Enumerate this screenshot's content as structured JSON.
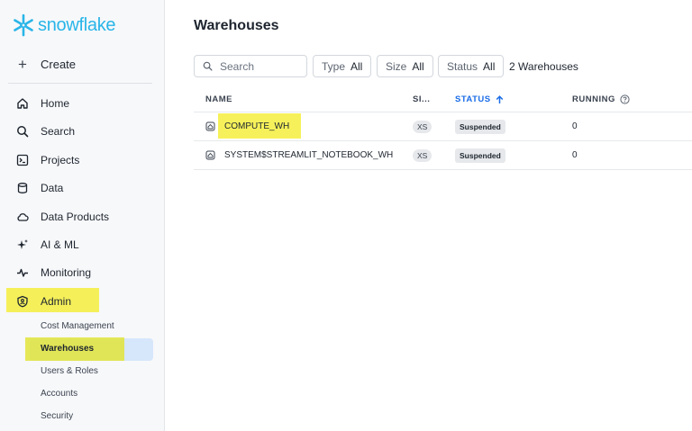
{
  "app": {
    "name": "snowflake"
  },
  "sidebar": {
    "create_label": "Create",
    "items": [
      {
        "label": "Home",
        "icon": "home-icon"
      },
      {
        "label": "Search",
        "icon": "search-icon"
      },
      {
        "label": "Projects",
        "icon": "terminal-icon"
      },
      {
        "label": "Data",
        "icon": "database-icon"
      },
      {
        "label": "Data Products",
        "icon": "cloud-icon"
      },
      {
        "label": "AI & ML",
        "icon": "sparkle-icon"
      },
      {
        "label": "Monitoring",
        "icon": "activity-icon"
      },
      {
        "label": "Admin",
        "icon": "shield-icon"
      }
    ],
    "admin_sub": [
      {
        "label": "Cost Management"
      },
      {
        "label": "Warehouses",
        "active": true
      },
      {
        "label": "Users & Roles"
      },
      {
        "label": "Accounts"
      },
      {
        "label": "Security"
      }
    ]
  },
  "main": {
    "title": "Warehouses",
    "search_placeholder": "Search",
    "filters": [
      {
        "label": "Type",
        "value": "All"
      },
      {
        "label": "Size",
        "value": "All"
      },
      {
        "label": "Status",
        "value": "All"
      }
    ],
    "count_text": "2 Warehouses",
    "columns": {
      "name": "NAME",
      "size": "SI...",
      "status": "STATUS",
      "running": "RUNNING"
    },
    "rows": [
      {
        "name": "COMPUTE_WH",
        "size": "XS",
        "status": "Suspended",
        "running": "0"
      },
      {
        "name": "SYSTEM$STREAMLIT_NOTEBOOK_WH",
        "size": "XS",
        "status": "Suspended",
        "running": "0"
      }
    ]
  },
  "colors": {
    "brand": "#29b5e8",
    "accent": "#1a6ce7",
    "highlight": "#f5ef3d",
    "selected": "#d6e6fb"
  }
}
